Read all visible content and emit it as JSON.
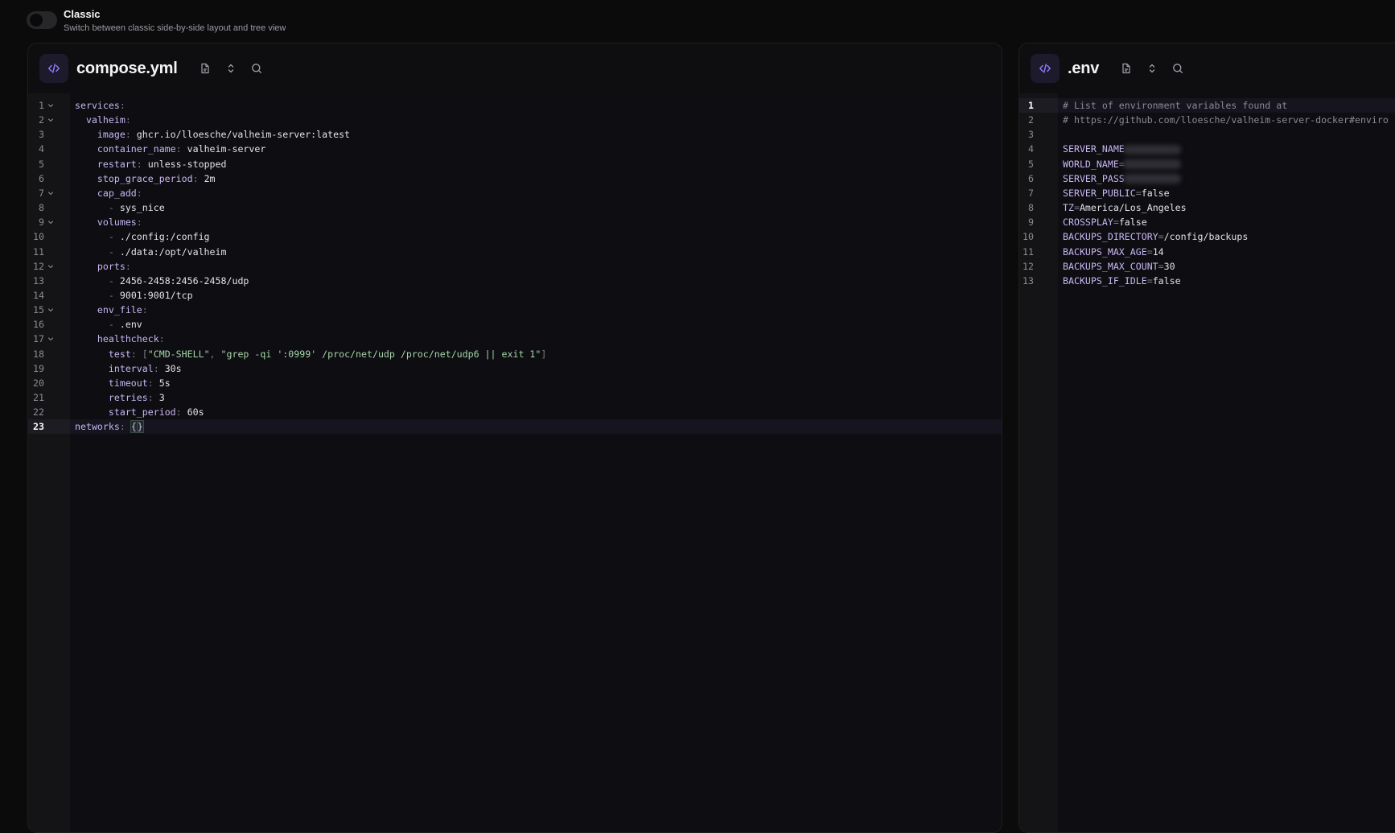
{
  "toggle": {
    "title": "Classic",
    "subtitle": "Switch between classic side-by-side layout and tree view"
  },
  "compose_panel": {
    "title": "compose.yml",
    "active_line": 23,
    "fold_lines": [
      1,
      2,
      7,
      9,
      12,
      15,
      17
    ],
    "lines": [
      [
        [
          "k",
          "services"
        ],
        [
          "p",
          ":"
        ]
      ],
      [
        [
          "v",
          "  "
        ],
        [
          "k",
          "valheim"
        ],
        [
          "p",
          ":"
        ]
      ],
      [
        [
          "v",
          "    "
        ],
        [
          "k",
          "image"
        ],
        [
          "p",
          ": "
        ],
        [
          "v",
          "ghcr.io/lloesche/valheim-server:latest"
        ]
      ],
      [
        [
          "v",
          "    "
        ],
        [
          "k",
          "container_name"
        ],
        [
          "p",
          ": "
        ],
        [
          "v",
          "valheim-server"
        ]
      ],
      [
        [
          "v",
          "    "
        ],
        [
          "k",
          "restart"
        ],
        [
          "p",
          ": "
        ],
        [
          "v",
          "unless-stopped"
        ]
      ],
      [
        [
          "v",
          "    "
        ],
        [
          "k",
          "stop_grace_period"
        ],
        [
          "p",
          ": "
        ],
        [
          "v",
          "2m"
        ]
      ],
      [
        [
          "v",
          "    "
        ],
        [
          "k",
          "cap_add"
        ],
        [
          "p",
          ":"
        ]
      ],
      [
        [
          "v",
          "      "
        ],
        [
          "p",
          "- "
        ],
        [
          "v",
          "sys_nice"
        ]
      ],
      [
        [
          "v",
          "    "
        ],
        [
          "k",
          "volumes"
        ],
        [
          "p",
          ":"
        ]
      ],
      [
        [
          "v",
          "      "
        ],
        [
          "p",
          "- "
        ],
        [
          "v",
          "./config:/config"
        ]
      ],
      [
        [
          "v",
          "      "
        ],
        [
          "p",
          "- "
        ],
        [
          "v",
          "./data:/opt/valheim"
        ]
      ],
      [
        [
          "v",
          "    "
        ],
        [
          "k",
          "ports"
        ],
        [
          "p",
          ":"
        ]
      ],
      [
        [
          "v",
          "      "
        ],
        [
          "p",
          "- "
        ],
        [
          "v",
          "2456-2458:2456-2458/udp"
        ]
      ],
      [
        [
          "v",
          "      "
        ],
        [
          "p",
          "- "
        ],
        [
          "v",
          "9001:9001/tcp"
        ]
      ],
      [
        [
          "v",
          "    "
        ],
        [
          "k",
          "env_file"
        ],
        [
          "p",
          ":"
        ]
      ],
      [
        [
          "v",
          "      "
        ],
        [
          "p",
          "- "
        ],
        [
          "v",
          ".env"
        ]
      ],
      [
        [
          "v",
          "    "
        ],
        [
          "k",
          "healthcheck"
        ],
        [
          "p",
          ":"
        ]
      ],
      [
        [
          "v",
          "      "
        ],
        [
          "k",
          "test"
        ],
        [
          "p",
          ": ["
        ],
        [
          "s",
          "\"CMD-SHELL\""
        ],
        [
          "p",
          ", "
        ],
        [
          "s",
          "\"grep -qi ':0999' /proc/net/udp /proc/net/udp6 || exit 1\""
        ],
        [
          "p",
          "]"
        ]
      ],
      [
        [
          "v",
          "      "
        ],
        [
          "k",
          "interval"
        ],
        [
          "p",
          ": "
        ],
        [
          "v",
          "30s"
        ]
      ],
      [
        [
          "v",
          "      "
        ],
        [
          "k",
          "timeout"
        ],
        [
          "p",
          ": "
        ],
        [
          "v",
          "5s"
        ]
      ],
      [
        [
          "v",
          "      "
        ],
        [
          "k",
          "retries"
        ],
        [
          "p",
          ": "
        ],
        [
          "v",
          "3"
        ]
      ],
      [
        [
          "v",
          "      "
        ],
        [
          "k",
          "start_period"
        ],
        [
          "p",
          ": "
        ],
        [
          "v",
          "60s"
        ]
      ],
      [
        [
          "k",
          "networks"
        ],
        [
          "p",
          ": "
        ],
        [
          "br",
          "{"
        ],
        [
          "cur",
          ""
        ],
        [
          "br",
          "}"
        ]
      ]
    ]
  },
  "env_panel": {
    "title": ".env",
    "active_line": 1,
    "lines": [
      [
        [
          "c",
          "# List of environment variables found at"
        ]
      ],
      [
        [
          "c",
          "# https://github.com/lloesche/valheim-server-docker#enviro"
        ]
      ],
      [],
      [
        [
          "k",
          "SERVER_NAME"
        ],
        [
          "blur",
          ""
        ]
      ],
      [
        [
          "k",
          "WORLD_NAME"
        ],
        [
          "p",
          "="
        ],
        [
          "blur",
          ""
        ]
      ],
      [
        [
          "k",
          "SERVER_PASS"
        ],
        [
          "blur",
          ""
        ]
      ],
      [
        [
          "k",
          "SERVER_PUBLIC"
        ],
        [
          "p",
          "="
        ],
        [
          "v",
          "false"
        ]
      ],
      [
        [
          "k",
          "TZ"
        ],
        [
          "p",
          "="
        ],
        [
          "v",
          "America/Los_Angeles"
        ]
      ],
      [
        [
          "k",
          "CROSSPLAY"
        ],
        [
          "p",
          "="
        ],
        [
          "v",
          "false"
        ]
      ],
      [
        [
          "k",
          "BACKUPS_DIRECTORY"
        ],
        [
          "p",
          "="
        ],
        [
          "v",
          "/config/backups"
        ]
      ],
      [
        [
          "k",
          "BACKUPS_MAX_AGE"
        ],
        [
          "p",
          "="
        ],
        [
          "v",
          "14"
        ]
      ],
      [
        [
          "k",
          "BACKUPS_MAX_COUNT"
        ],
        [
          "p",
          "="
        ],
        [
          "v",
          "30"
        ]
      ],
      [
        [
          "k",
          "BACKUPS_IF_IDLE"
        ],
        [
          "p",
          "="
        ],
        [
          "v",
          "false"
        ]
      ]
    ]
  },
  "icons": {
    "code": "code-icon",
    "file": "file-icon",
    "expand": "chevron-up-down-icon",
    "search": "search-icon"
  },
  "colors": {
    "accent": "#8b7cf6",
    "key": "#c9b7f2",
    "string": "#a5d6a7",
    "background": "#0b0b0c"
  }
}
